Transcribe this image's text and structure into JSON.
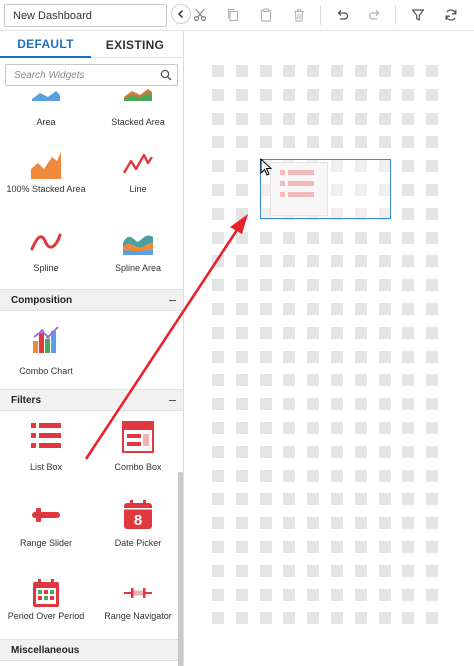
{
  "toolbar": {
    "dashboard_name": "New Dashboard",
    "buttons": [
      {
        "name": "cut",
        "icon": "scissors-icon"
      },
      {
        "name": "copy",
        "icon": "copy-icon"
      },
      {
        "name": "paste",
        "icon": "paste-icon"
      },
      {
        "name": "delete",
        "icon": "trash-icon"
      },
      {
        "name": "undo",
        "icon": "undo-icon"
      },
      {
        "name": "redo",
        "icon": "redo-icon"
      },
      {
        "name": "filter",
        "icon": "filter-icon"
      },
      {
        "name": "refresh",
        "icon": "refresh-icon"
      }
    ]
  },
  "panel": {
    "tabs": [
      {
        "label": "DEFAULT",
        "active": true
      },
      {
        "label": "EXISTING",
        "active": false
      }
    ],
    "search": {
      "placeholder": "Search Widgets"
    },
    "widgets": {
      "area": "Area",
      "stacked_area": "Stacked Area",
      "stacked_area_100": "100% Stacked Area",
      "line": "Line",
      "spline": "Spline",
      "spline_area": "Spline Area",
      "combo_chart": "Combo Chart",
      "list_box": "List Box",
      "combo_box": "Combo Box",
      "range_slider": "Range Slider",
      "date_picker": "Date Picker",
      "date_picker_day": "8",
      "period_over_period": "Period Over Period",
      "range_navigator": "Range Navigator"
    },
    "sections": {
      "composition": "Composition",
      "filters": "Filters",
      "miscellaneous": "Miscellaneous"
    }
  },
  "colors": {
    "accent_blue": "#1d6fbf",
    "widget_red": "#e0383e",
    "drag_arrow": "#e8212b",
    "selection_blue": "#3a8ed8"
  }
}
